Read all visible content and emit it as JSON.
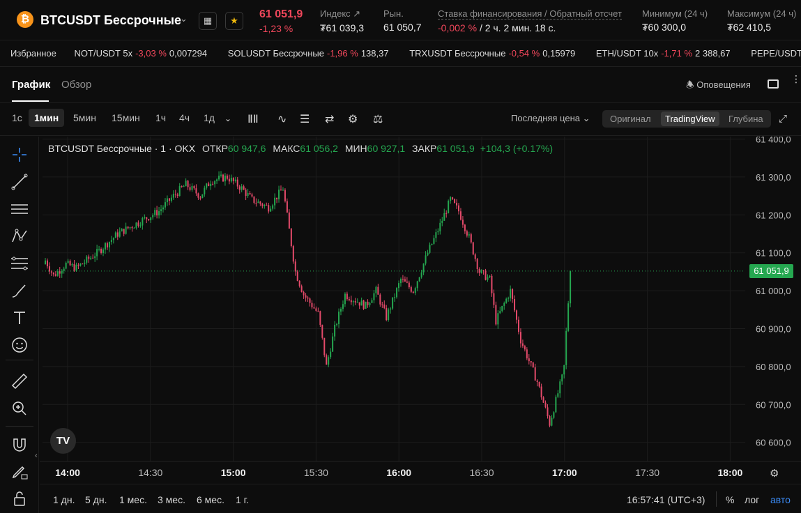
{
  "header": {
    "coin_symbol": "₿",
    "pair_title": "BTCUSDT Бессрочные",
    "last_price": "61 051,9",
    "change": "-1,23 %",
    "index_label": "Индекс",
    "index_value": "₮61 039,3",
    "market_label": "Рын.",
    "market_value": "61 050,7",
    "funding_label": "Ставка финансирования / Обратный отсчет",
    "funding_rate": "-0,002 %",
    "funding_countdown": "/ 2 ч. 2 мин. 18 с.",
    "low_label": "Минимум (24 ч)",
    "low_value": "₮60 300,0",
    "high_label": "Максимум (24 ч)",
    "high_value": "₮62 410,5"
  },
  "ticker": {
    "label": "Избранное",
    "items": [
      {
        "name": "NOT/USDT 5x",
        "change": "-3,03 %",
        "price": "0,007294"
      },
      {
        "name": "SOLUSDT Бессрочные",
        "change": "-1,96 %",
        "price": "138,37"
      },
      {
        "name": "TRXUSDT Бессрочные",
        "change": "-0,54 %",
        "price": "0,15979"
      },
      {
        "name": "ETH/USDT 10x",
        "change": "-1,71 %",
        "price": "2 388,67"
      },
      {
        "name": "PEPE/USDT 5x",
        "change": "",
        "price": ""
      }
    ]
  },
  "tabs": {
    "chart": "График",
    "overview": "Обзор",
    "alerts": "Оповещения"
  },
  "toolbar": {
    "timeframes": [
      "1с",
      "1мин",
      "5мин",
      "15мин",
      "1ч",
      "4ч",
      "1д"
    ],
    "selected_timeframe": "1мин",
    "price_type": "Последняя цена",
    "views": [
      "Оригинал",
      "TradingView",
      "Глубина"
    ],
    "selected_view": "TradingView"
  },
  "legend": {
    "symbol": "BTCUSDT Бессрочные · 1 · OKX",
    "open_label": "ОТКР",
    "open": "60 947,6",
    "high_label": "МАКС",
    "high": "61 056,2",
    "low_label": "МИН",
    "low": "60 927,1",
    "close_label": "ЗАКР",
    "close": "61 051,9",
    "change": "+104,3 (+0.17%)"
  },
  "price_tag": "61 051,9",
  "bottom": {
    "ranges": [
      "1 дн.",
      "5 дн.",
      "1 мес.",
      "3 мес.",
      "6 мес.",
      "1 г."
    ],
    "clock": "16:57:41 (UTC+3)",
    "percent": "%",
    "log": "лог",
    "auto": "авто"
  },
  "colors": {
    "up": "#25a750",
    "down": "#e44a6a",
    "accent": "#3b8bf5",
    "background": "#0d0d0d"
  },
  "chart_data": {
    "type": "candlestick",
    "y_axis_ticks": [
      "61 400,0",
      "61 300,0",
      "61 200,0",
      "61 100,0",
      "61 000,0",
      "60 900,0",
      "60 800,0",
      "60 700,0",
      "60 600,0"
    ],
    "ylim": [
      60580,
      61410
    ],
    "x_axis_ticks": [
      "14:00",
      "14:30",
      "15:00",
      "15:30",
      "16:00",
      "16:30",
      "17:00",
      "17:30",
      "18:00"
    ],
    "x_axis_bold": [
      "14:00",
      "15:00",
      "16:00",
      "17:00",
      "18:00"
    ],
    "last_price": 61051.9,
    "grid": true,
    "close_path": [
      [
        0,
        61080
      ],
      [
        4,
        61040
      ],
      [
        10,
        61070
      ],
      [
        15,
        61060
      ],
      [
        25,
        61100
      ],
      [
        35,
        61150
      ],
      [
        45,
        61180
      ],
      [
        55,
        61210
      ],
      [
        62,
        61250
      ],
      [
        68,
        61280
      ],
      [
        75,
        61250
      ],
      [
        80,
        61290
      ],
      [
        88,
        61300
      ],
      [
        95,
        61270
      ],
      [
        100,
        61240
      ],
      [
        108,
        61220
      ],
      [
        115,
        61270
      ],
      [
        121,
        61050
      ],
      [
        125,
        60990
      ],
      [
        132,
        60940
      ],
      [
        136,
        60800
      ],
      [
        140,
        60900
      ],
      [
        145,
        60990
      ],
      [
        155,
        60960
      ],
      [
        160,
        61000
      ],
      [
        165,
        60930
      ],
      [
        172,
        61030
      ],
      [
        178,
        61000
      ],
      [
        185,
        61100
      ],
      [
        190,
        61160
      ],
      [
        196,
        61240
      ],
      [
        200,
        61210
      ],
      [
        205,
        61140
      ],
      [
        210,
        61050
      ],
      [
        215,
        61030
      ],
      [
        218,
        60920
      ],
      [
        225,
        61000
      ],
      [
        230,
        60870
      ],
      [
        238,
        60760
      ],
      [
        244,
        60650
      ],
      [
        250,
        60770
      ],
      [
        251,
        60800
      ],
      [
        252,
        60890
      ],
      [
        253,
        60970
      ],
      [
        254,
        61051.9
      ]
    ]
  }
}
